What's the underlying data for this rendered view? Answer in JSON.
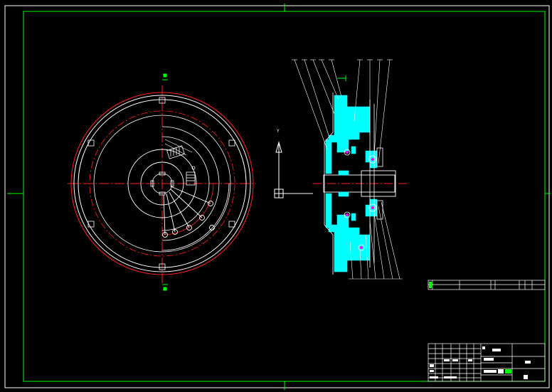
{
  "drawing": {
    "background": "#000000",
    "frame_color": "#00ff00",
    "line_color": "#ffffff",
    "center_line_color": "#ff2020",
    "section_color": "#00ffff",
    "accent_color": "#00ff00",
    "magenta_color": "#ff00ff"
  },
  "front_view": {
    "name": "clutch-front-view",
    "bolt_count": 8
  },
  "side_view": {
    "name": "clutch-section-view",
    "balloon_top_count": 9,
    "balloon_bottom_count": 7
  },
  "axis_indicator": {
    "label": "Y"
  },
  "title_block": {
    "name": "title-block"
  },
  "parts_list": {
    "name": "parts-list-row"
  }
}
